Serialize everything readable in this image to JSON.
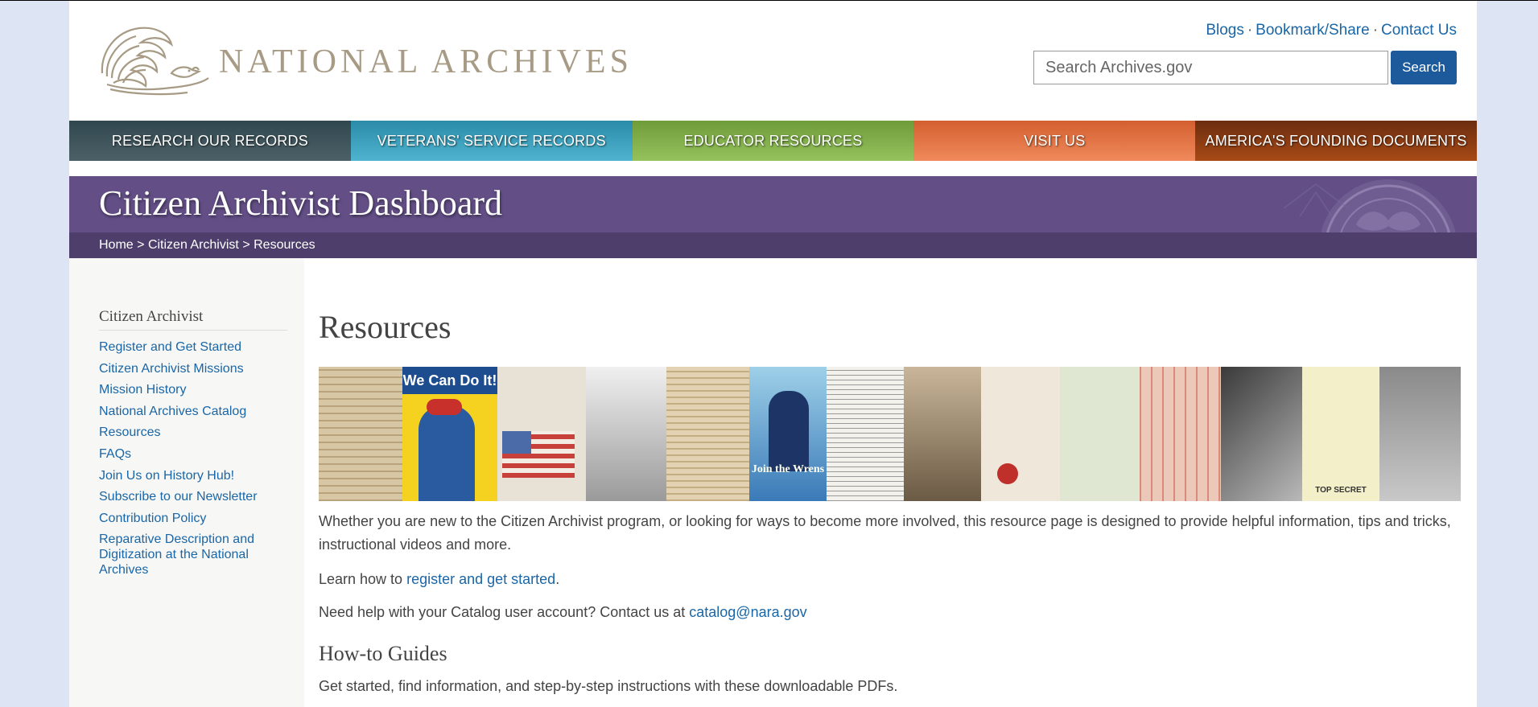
{
  "header": {
    "logo_text": "NATIONAL ARCHIVES",
    "utility_links": [
      "Blogs",
      "Bookmark/Share",
      "Contact Us"
    ],
    "search": {
      "placeholder": "Search Archives.gov",
      "button_label": "Search"
    }
  },
  "nav": {
    "items": [
      {
        "label": "RESEARCH OUR RECORDS"
      },
      {
        "label": "VETERANS' SERVICE RECORDS"
      },
      {
        "label": "EDUCATOR RESOURCES"
      },
      {
        "label": "VISIT US"
      },
      {
        "label": "AMERICA'S FOUNDING DOCUMENTS"
      }
    ]
  },
  "banner": {
    "title": "Citizen Archivist Dashboard"
  },
  "breadcrumb": {
    "items": [
      "Home",
      "Citizen Archivist",
      "Resources"
    ],
    "separator": ">"
  },
  "sidebar": {
    "title": "Citizen Archivist",
    "items": [
      "Register and Get Started",
      "Citizen Archivist Missions",
      "Mission History",
      "National Archives Catalog",
      "Resources",
      "FAQs",
      "Join Us on History Hub!",
      "Subscribe to our Newsletter",
      "Contribution Policy",
      "Reparative Description and Digitization at the National Archives"
    ]
  },
  "main": {
    "title": "Resources",
    "intro": "Whether you are new to the Citizen Archivist program, or looking for ways to become more involved, this resource page is designed to provide helpful information, tips and tricks, instructional videos and more.",
    "register_prefix": "Learn how to ",
    "register_link": "register and get started",
    "register_suffix": ".",
    "help_prefix": "Need help with your Catalog user account? Contact us at ",
    "help_email": "catalog@nara.gov",
    "howto_title": "How-to Guides",
    "howto_text": "Get started, find information, and step-by-step instructions with these downloadable PDFs.",
    "poster_we_can": "We Can Do It!",
    "poster_wrens": "Join the Wrens",
    "poster_top_secret": "TOP SECRET"
  },
  "colors": {
    "link": "#1a66a6",
    "banner": "#634f86",
    "breadcrumb_bar": "#4d3e6b",
    "search_button": "#1c5a9c"
  }
}
